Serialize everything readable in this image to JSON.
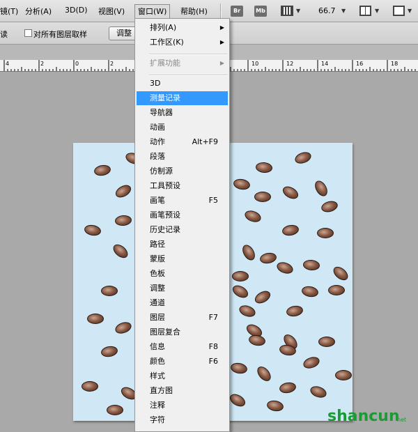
{
  "menubar": {
    "items": [
      "镜(T)",
      "分析(A)",
      "3D(D)",
      "视图(V)",
      "窗口(W)",
      "帮助(H)"
    ],
    "icons": [
      "Br",
      "Mb"
    ],
    "zoom": "66.7"
  },
  "options_bar": {
    "prefix": "读",
    "checkbox_label": "对所有图层取样",
    "button_label": "调整边"
  },
  "ruler": {
    "labels": [
      "4",
      "2",
      "0",
      "2",
      "10",
      "12",
      "14",
      "16",
      "18"
    ]
  },
  "window_menu": {
    "top_items": [
      {
        "label": "排列(A)",
        "submenu": true
      },
      {
        "label": "工作区(K)",
        "submenu": true
      }
    ],
    "extensions": {
      "label": "扩展功能",
      "submenu": true,
      "disabled": true
    },
    "items": [
      {
        "label": "3D",
        "shortcut": ""
      },
      {
        "label": "测量记录",
        "shortcut": "",
        "highlighted": true
      },
      {
        "label": "导航器",
        "shortcut": ""
      },
      {
        "label": "动画",
        "shortcut": ""
      },
      {
        "label": "动作",
        "shortcut": "Alt+F9"
      },
      {
        "label": "段落",
        "shortcut": ""
      },
      {
        "label": "仿制源",
        "shortcut": ""
      },
      {
        "label": "工具预设",
        "shortcut": ""
      },
      {
        "label": "画笔",
        "shortcut": "F5"
      },
      {
        "label": "画笔预设",
        "shortcut": ""
      },
      {
        "label": "历史记录",
        "shortcut": ""
      },
      {
        "label": "路径",
        "shortcut": ""
      },
      {
        "label": "蒙版",
        "shortcut": ""
      },
      {
        "label": "色板",
        "shortcut": ""
      },
      {
        "label": "调整",
        "shortcut": ""
      },
      {
        "label": "通道",
        "shortcut": ""
      },
      {
        "label": "图层",
        "shortcut": "F7"
      },
      {
        "label": "图层复合",
        "shortcut": ""
      },
      {
        "label": "信息",
        "shortcut": "F8"
      },
      {
        "label": "颜色",
        "shortcut": "F6"
      },
      {
        "label": "样式",
        "shortcut": ""
      },
      {
        "label": "直方图",
        "shortcut": ""
      },
      {
        "label": "注释",
        "shortcut": ""
      },
      {
        "label": "字符",
        "shortcut": ""
      }
    ]
  },
  "watermark": {
    "text": "shancun",
    "domain": "net"
  }
}
